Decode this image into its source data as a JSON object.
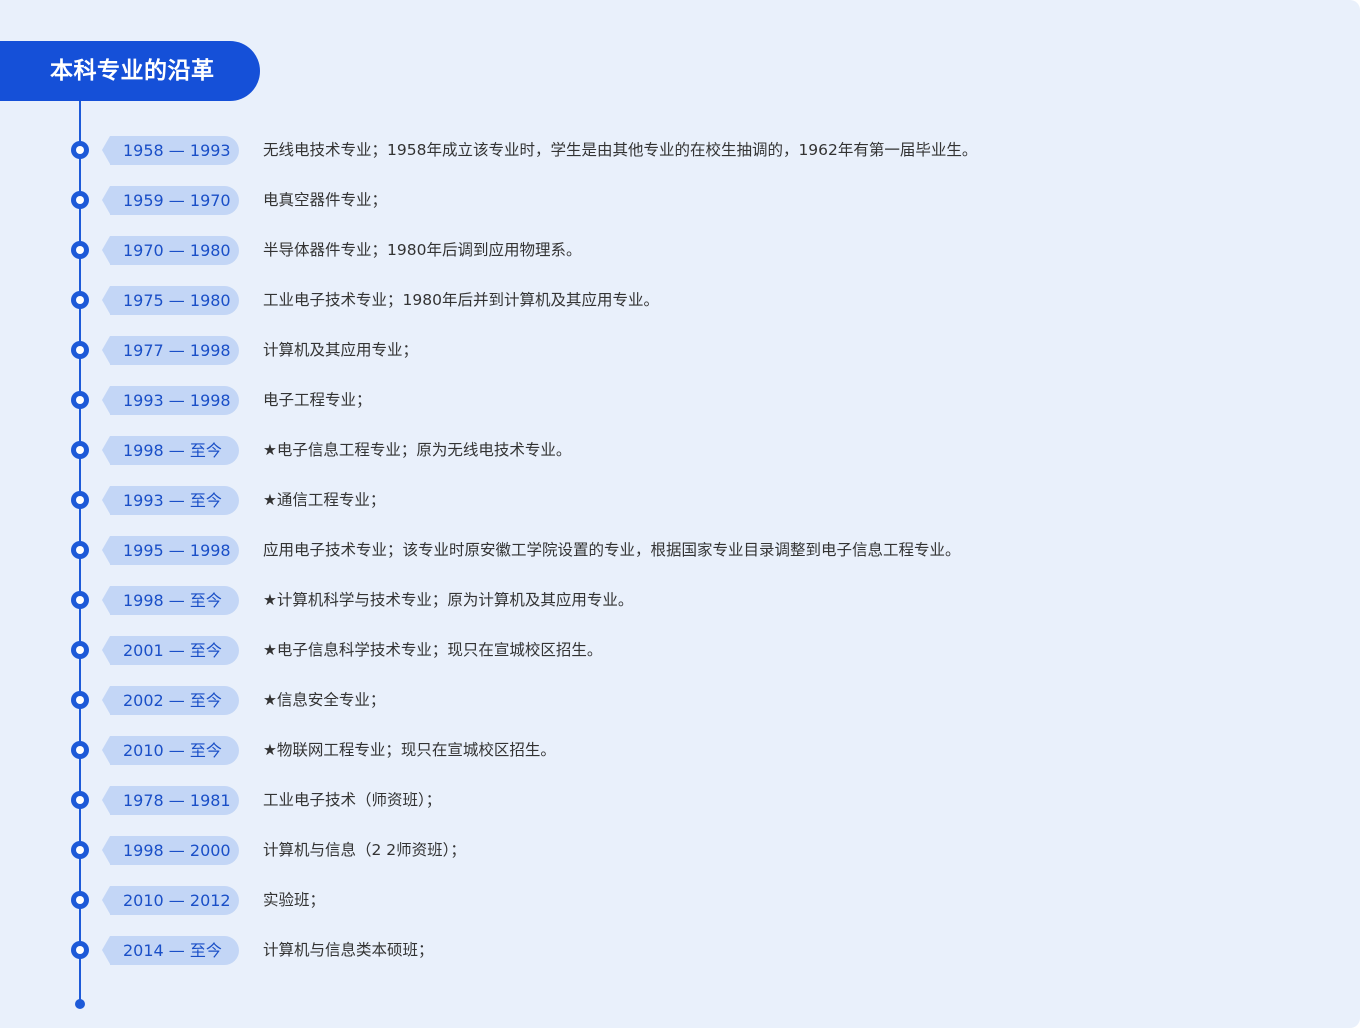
{
  "header": {
    "title": "本科专业的沿革"
  },
  "colors": {
    "accent": "#1550d8",
    "pill_bg": "#c3d6f6",
    "pill_text": "#1a4fc7",
    "panel_bg": "#e9f0fb",
    "body_text": "#333333"
  },
  "timeline": [
    {
      "period": "1958 — 1993",
      "text": "无线电技术专业；1958年成立该专业时，学生是由其他专业的在校生抽调的，1962年有第一届毕业生。"
    },
    {
      "period": "1959 — 1970",
      "text": "电真空器件专业；"
    },
    {
      "period": "1970 — 1980",
      "text": "半导体器件专业；1980年后调到应用物理系。"
    },
    {
      "period": "1975 — 1980",
      "text": "工业电子技术专业；1980年后并到计算机及其应用专业。"
    },
    {
      "period": "1977 — 1998",
      "text": "计算机及其应用专业；"
    },
    {
      "period": "1993 — 1998",
      "text": "电子工程专业；"
    },
    {
      "period": "1998 — 至今",
      "text": "★电子信息工程专业；原为无线电技术专业。"
    },
    {
      "period": "1993 — 至今",
      "text": "★通信工程专业；"
    },
    {
      "period": "1995 — 1998",
      "text": "应用电子技术专业；该专业时原安徽工学院设置的专业，根据国家专业目录调整到电子信息工程专业。"
    },
    {
      "period": "1998 — 至今",
      "text": "★计算机科学与技术专业；原为计算机及其应用专业。"
    },
    {
      "period": "2001 — 至今",
      "text": "★电子信息科学技术专业；现只在宣城校区招生。"
    },
    {
      "period": "2002 — 至今",
      "text": "★信息安全专业；"
    },
    {
      "period": "2010 — 至今",
      "text": "★物联网工程专业；现只在宣城校区招生。"
    },
    {
      "period": "1978 — 1981",
      "text": "工业电子技术（师资班）；"
    },
    {
      "period": "1998 — 2000",
      "text": "计算机与信息（2 2师资班）；"
    },
    {
      "period": "2010 — 2012",
      "text": "实验班；"
    },
    {
      "period": "2014 — 至今",
      "text": "计算机与信息类本硕班；"
    }
  ]
}
